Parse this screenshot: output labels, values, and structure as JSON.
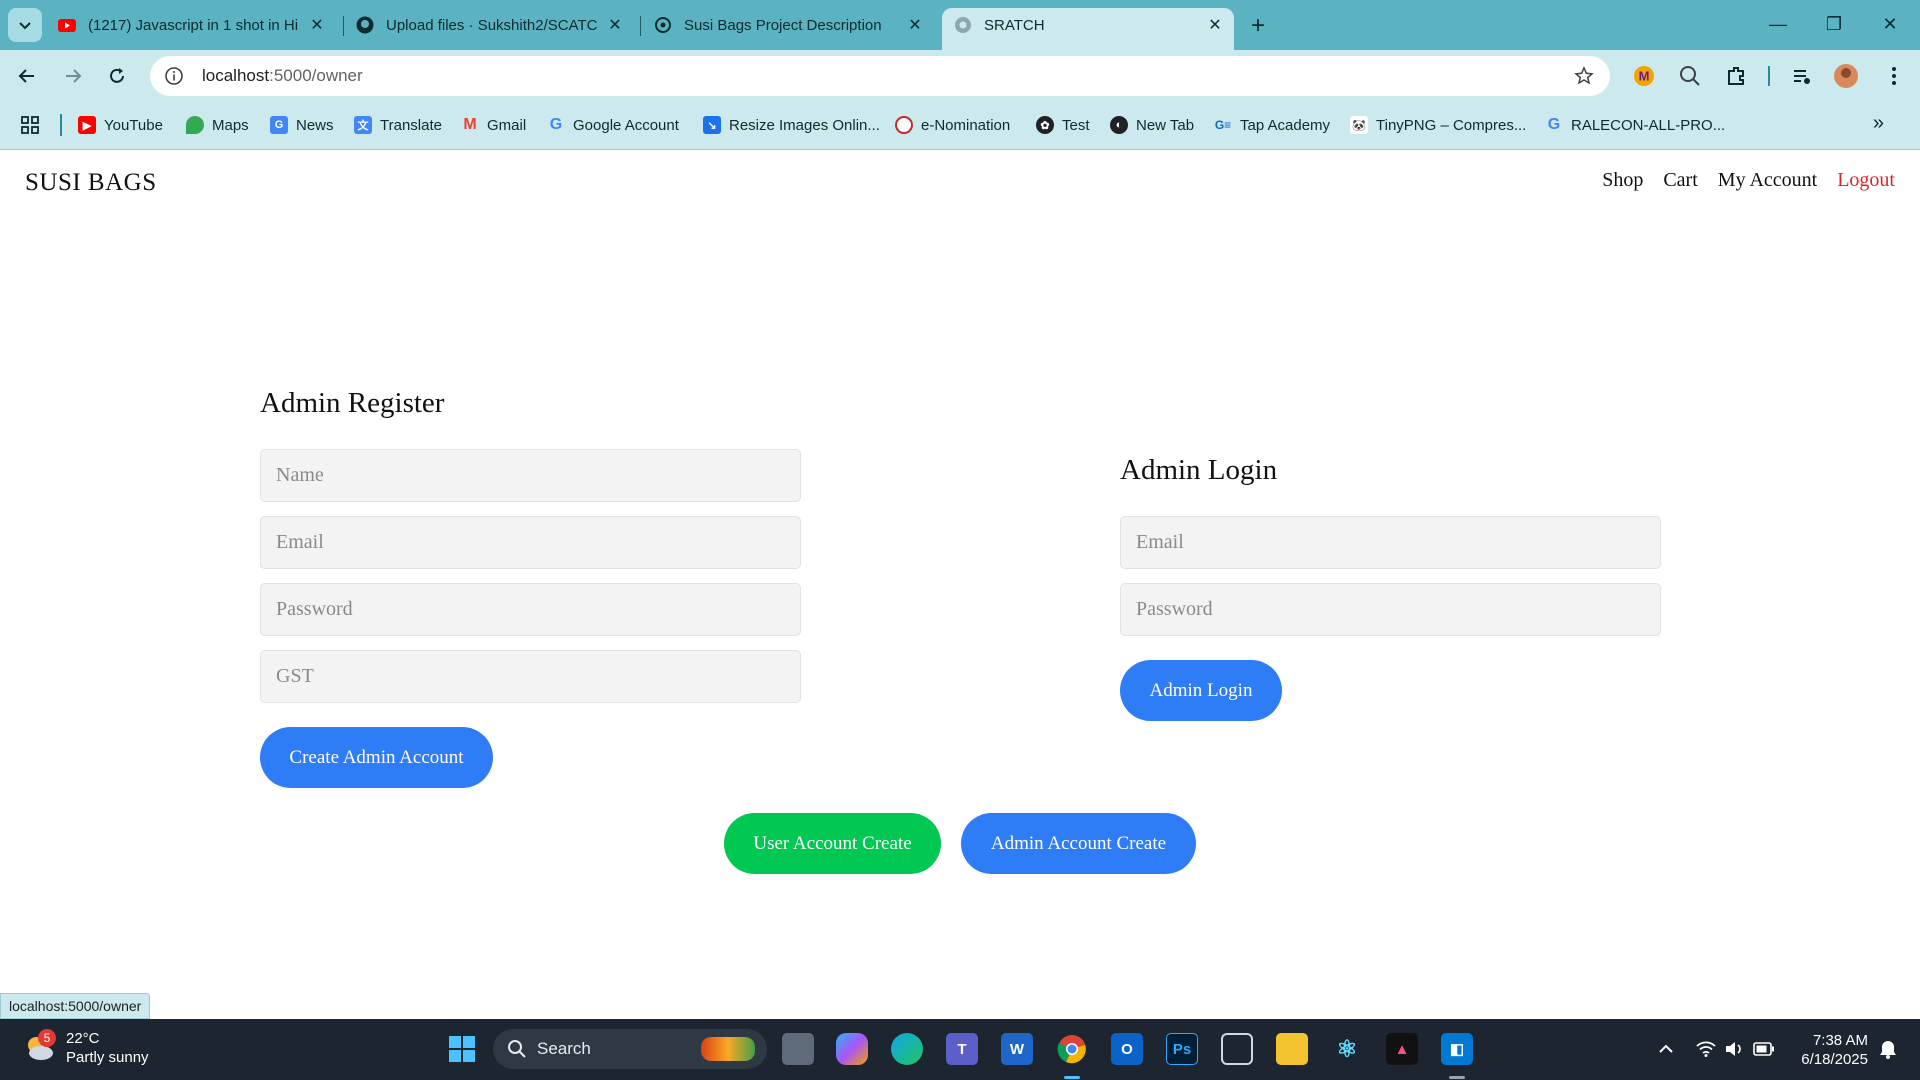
{
  "browser": {
    "tabs": [
      {
        "title": "(1217) Javascript in 1 shot in Hi",
        "icon": "youtube-icon",
        "active": false
      },
      {
        "title": "Upload files · Sukshith2/SCATCH",
        "icon": "github-icon",
        "active": false
      },
      {
        "title": "Susi Bags Project Description",
        "icon": "chatgpt-icon",
        "active": false
      },
      {
        "title": "SRATCH",
        "icon": "globe-icon",
        "active": true
      }
    ],
    "url_host": "localhost",
    "url_path": ":5000/owner",
    "bookmarks": [
      {
        "label": "YouTube",
        "icon": "youtube-icon",
        "color": "#ff0000"
      },
      {
        "label": "Maps",
        "icon": "maps-icon",
        "color": "#34a853"
      },
      {
        "label": "News",
        "icon": "news-icon",
        "color": "#4285f4"
      },
      {
        "label": "Translate",
        "icon": "translate-icon",
        "color": "#4285f4"
      },
      {
        "label": "Gmail",
        "icon": "gmail-icon",
        "color": "#ea4335"
      },
      {
        "label": "Google Account",
        "icon": "google-icon",
        "color": "#4285f4"
      },
      {
        "label": "Resize Images Onlin...",
        "icon": "resize-icon",
        "color": "#1a73e8"
      },
      {
        "label": "e-Nomination",
        "icon": "enomination-icon",
        "color": "#c62828"
      },
      {
        "label": "Test",
        "icon": "openai-icon",
        "color": "#202124"
      },
      {
        "label": "New Tab",
        "icon": "globe-icon",
        "color": "#202124"
      },
      {
        "label": "Tap Academy",
        "icon": "tap-academy-icon",
        "color": "#1565c0"
      },
      {
        "label": "TinyPNG – Compres...",
        "icon": "panda-icon",
        "color": "#333333"
      },
      {
        "label": "RALECON-ALL-PRO...",
        "icon": "google-icon",
        "color": "#4285f4"
      }
    ],
    "status_url": "localhost:5000/owner"
  },
  "site": {
    "brand": "SUSI BAGS",
    "nav": {
      "shop": "Shop",
      "cart": "Cart",
      "account": "My Account",
      "logout": "Logout"
    },
    "register": {
      "heading": "Admin Register",
      "name_placeholder": "Name",
      "email_placeholder": "Email",
      "password_placeholder": "Password",
      "gst_placeholder": "GST",
      "submit": "Create Admin Account"
    },
    "login": {
      "heading": "Admin Login",
      "email_placeholder": "Email",
      "password_placeholder": "Password",
      "submit": "Admin Login"
    },
    "switch": {
      "user": "User Account Create",
      "admin": "Admin Account Create"
    },
    "colors": {
      "primary": "#2e7cf6",
      "success": "#00c853",
      "danger": "#dc2626"
    }
  },
  "taskbar": {
    "weather_temp": "22°C",
    "weather_desc": "Partly sunny",
    "weather_badge": "5",
    "search_label": "Search",
    "time": "7:38 AM",
    "date": "6/18/2025"
  }
}
